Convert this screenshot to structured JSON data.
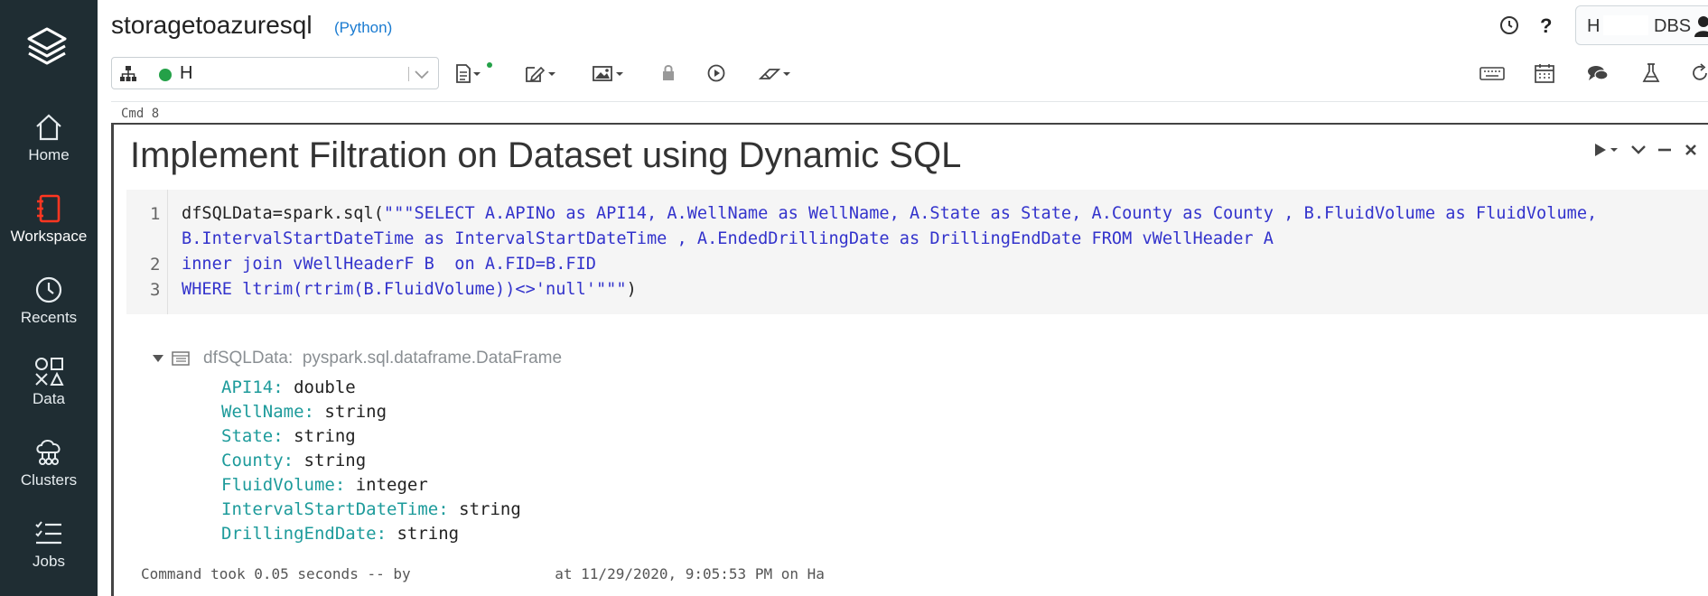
{
  "nav": {
    "items": [
      {
        "label": "Home",
        "icon": "home-icon"
      },
      {
        "label": "Workspace",
        "icon": "workspace-icon",
        "active": true
      },
      {
        "label": "Recents",
        "icon": "clock-icon"
      },
      {
        "label": "Data",
        "icon": "data-icon"
      },
      {
        "label": "Clusters",
        "icon": "clusters-icon"
      },
      {
        "label": "Jobs",
        "icon": "jobs-icon"
      }
    ],
    "active_color": "#ff3621"
  },
  "header": {
    "notebook_name": "storagetoazuresql",
    "language": "(Python)",
    "user_initial": "H",
    "user_org": "DBS"
  },
  "toolbar": {
    "cluster_name": "H",
    "cluster_status_color": "#24a148"
  },
  "cell": {
    "cmd_label": "Cmd 8",
    "title": "Implement Filtration on Dataset using Dynamic SQL",
    "code": {
      "line_numbers": [
        "1",
        "2",
        "3"
      ],
      "line1a_pre": "dfSQLData=spark.sql(",
      "line1a_str": "\"\"\"SELECT A.APINo as API14, A.WellName as WellName, A.State as State, A.County as County , B.FluidVolume as FluidVolume,",
      "line1b_str": "B.IntervalStartDateTime as IntervalStartDateTime , A.EndedDrillingDate as DrillingEndDate FROM vWellHeader A",
      "line2_str": "inner join vWellHeaderF B  on A.FID=B.FID",
      "line3_str": "WHERE ltrim(rtrim(B.FluidVolume))<>'null'\"\"\"",
      "line3_post": ")"
    },
    "output": {
      "var_name": "dfSQLData:",
      "var_type": "pyspark.sql.dataframe.DataFrame",
      "schema": [
        {
          "field": "API14:",
          "type": "double"
        },
        {
          "field": "WellName:",
          "type": "string"
        },
        {
          "field": "State:",
          "type": "string"
        },
        {
          "field": "County:",
          "type": "string"
        },
        {
          "field": "FluidVolume:",
          "type": "integer"
        },
        {
          "field": "IntervalStartDateTime:",
          "type": "string"
        },
        {
          "field": "DrillingEndDate:",
          "type": "string"
        }
      ]
    },
    "footer": {
      "prefix": "Command took 0.05 seconds -- by",
      "suffix": "at 11/29/2020, 9:05:53 PM on Ha"
    }
  }
}
